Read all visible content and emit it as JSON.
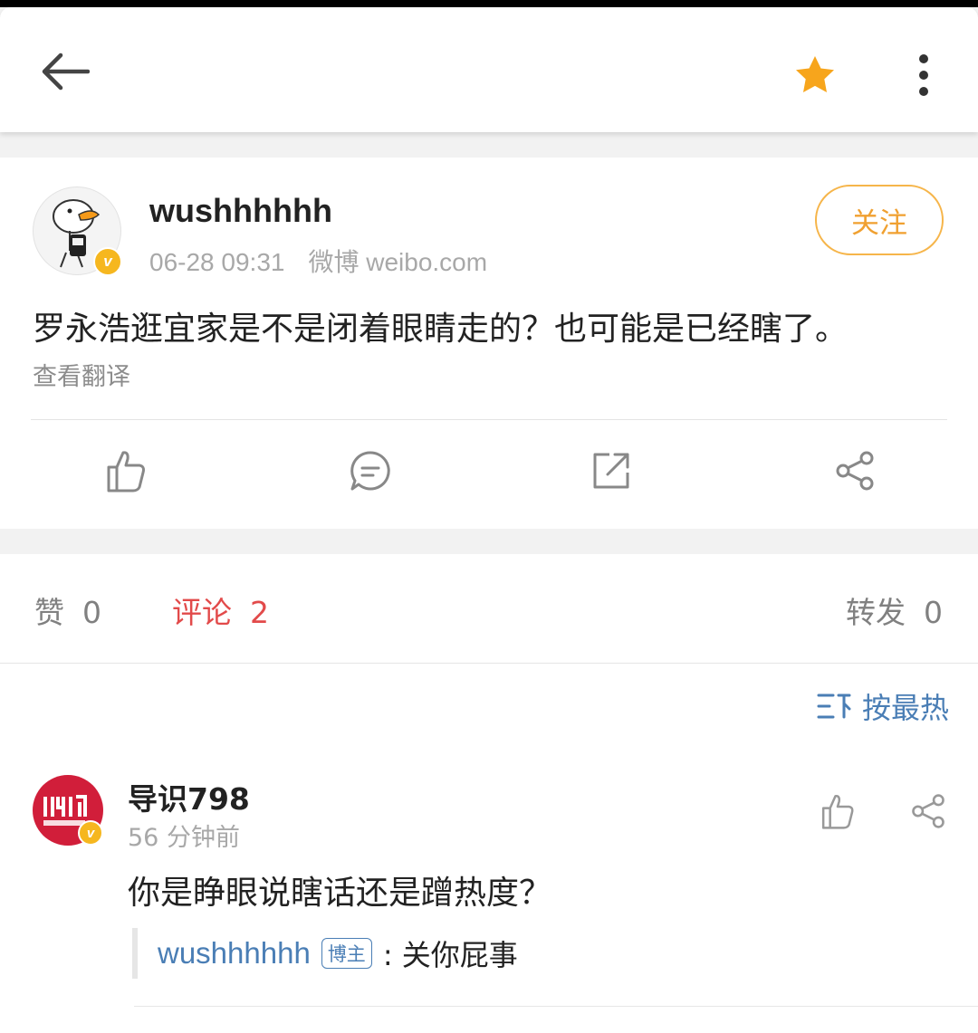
{
  "post": {
    "author": "wushhhhhh",
    "time": "06-28 09:31",
    "source": "微博 weibo.com",
    "follow_label": "关注",
    "text": "罗永浩逛宜家是不是闭着眼睛走的？也可能是已经瞎了。",
    "translate_label": "查看翻译",
    "verified_badge": "v",
    "actions": [
      "like-icon",
      "comment-icon",
      "repost-icon",
      "share-icon"
    ]
  },
  "stats": {
    "likes_label": "赞",
    "likes_count": "0",
    "comments_label": "评论",
    "comments_count": "2",
    "reposts_label": "转发",
    "reposts_count": "0"
  },
  "sort": {
    "label": "按最热"
  },
  "comments": [
    {
      "user": "导识798",
      "time": "56 分钟前",
      "text": "你是睁眼说瞎话还是蹭热度？",
      "verified_badge": "v",
      "reply": {
        "user": "wushhhhhh",
        "badge": "博主",
        "text": ": 关你屁事"
      }
    }
  ],
  "colors": {
    "accent_orange": "#f0a030",
    "comment_red": "#e24a4a",
    "link_blue": "#4a7eb5",
    "star": "#f7a51c"
  }
}
